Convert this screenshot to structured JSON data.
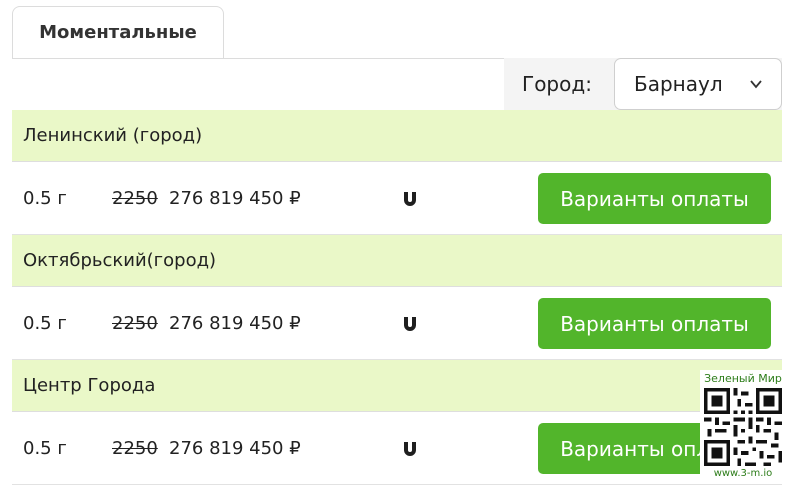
{
  "tabs": [
    {
      "label": "Моментальные",
      "active": true
    }
  ],
  "city": {
    "label": "Город:",
    "selected": "Барнаул"
  },
  "groups": [
    {
      "name": "Ленинский (город)",
      "items": [
        {
          "weight": "0.5 г",
          "old_price": "2250",
          "price": "276 819 450 ₽",
          "pay_label": "Варианты оплаты"
        }
      ]
    },
    {
      "name": "Октябрьский(город)",
      "items": [
        {
          "weight": "0.5 г",
          "old_price": "2250",
          "price": "276 819 450 ₽",
          "pay_label": "Варианты оплаты"
        }
      ]
    },
    {
      "name": "Центр Города",
      "items": [
        {
          "weight": "0.5 г",
          "old_price": "2250",
          "price": "276 819 450 ₽",
          "pay_label": "Варианты оплаты"
        }
      ]
    }
  ],
  "watermark": {
    "top_text": "Зеленый Мир",
    "bottom_text": "www.3-m.io"
  },
  "colors": {
    "accent_green": "#52b52b",
    "group_bg": "#eaf8c8"
  },
  "icons": {
    "magnet": "magnet-icon",
    "chevron": "chevron-down-icon",
    "qr": "qr-code-icon"
  }
}
